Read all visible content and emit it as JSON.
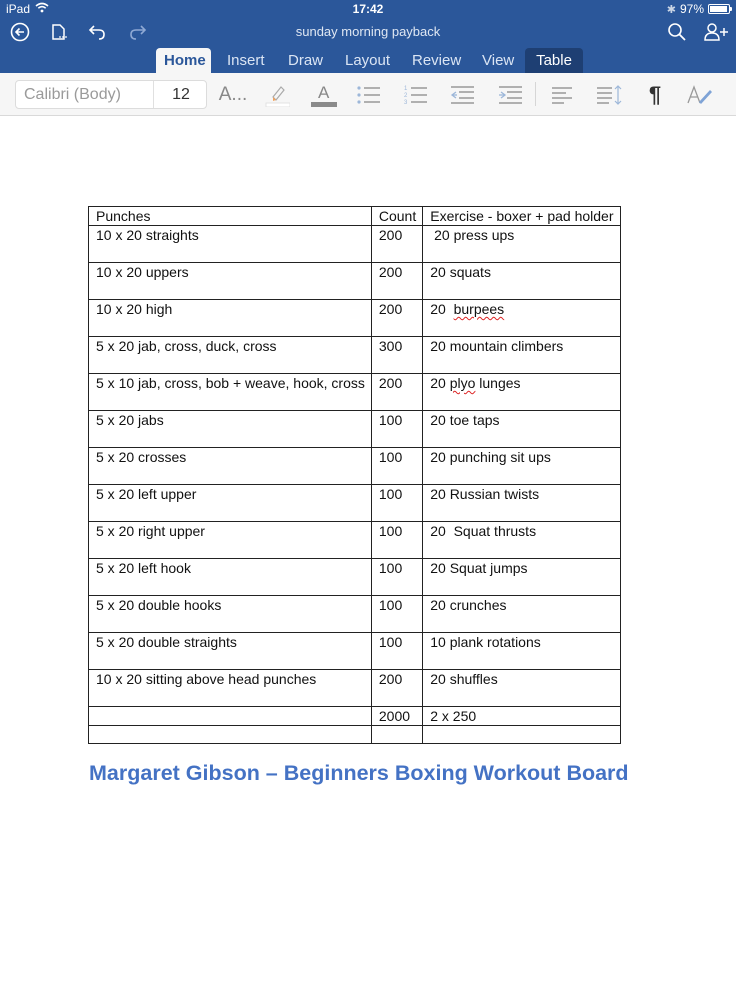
{
  "status_bar": {
    "device": "iPad",
    "time": "17:42",
    "battery": "97%",
    "battery_level": 0.97
  },
  "title_bar": {
    "document_title": "sunday morning payback",
    "icons": [
      "back-icon",
      "file-icon",
      "undo-icon",
      "redo-icon",
      "search-icon",
      "share-person-icon"
    ]
  },
  "tabs": [
    {
      "label": "Home",
      "active": true
    },
    {
      "label": "Insert"
    },
    {
      "label": "Draw"
    },
    {
      "label": "Layout"
    },
    {
      "label": "Review"
    },
    {
      "label": "View"
    },
    {
      "label": "Table",
      "contextual": true
    }
  ],
  "ribbon": {
    "font_name": "Calibri (Body)",
    "font_size": "12",
    "text_effects_label": "A...",
    "font_color_label": "A",
    "icons": [
      "text-effects-icon",
      "highlight-icon",
      "font-color-icon",
      "bullets-icon",
      "numbering-icon",
      "decrease-indent-icon",
      "increase-indent-icon",
      "align-left-icon",
      "line-spacing-icon",
      "paragraph-mark-icon",
      "styles-icon"
    ]
  },
  "document": {
    "table": {
      "headers": [
        "Punches",
        "Count",
        "Exercise - boxer + pad holder"
      ],
      "rows": [
        {
          "punches": "10 x 20  straights",
          "count": "200",
          "exercise": " 20 press ups"
        },
        {
          "punches": "10 x 20  uppers",
          "count": "200",
          "exercise": "20 squats"
        },
        {
          "punches": "10 x 20  high",
          "count": "200",
          "exercise_prefix": "20  ",
          "exercise_flagged": "burpees",
          "exercise_suffix": ""
        },
        {
          "punches": "5 x 20 jab, cross, duck, cross",
          "count": "300",
          "exercise": "20 mountain climbers"
        },
        {
          "punches": "5 x 10  jab, cross, bob + weave, hook, cross",
          "count": "200",
          "exercise_prefix": "20 ",
          "exercise_flagged": "plyo",
          "exercise_suffix": " lunges"
        },
        {
          "punches": "5 x 20  jabs",
          "count": "100",
          "exercise": "20 toe taps"
        },
        {
          "punches": "5 x 20  crosses",
          "count": "100",
          "exercise": "20 punching sit ups"
        },
        {
          "punches": "5 x 20  left upper",
          "count": "100",
          "exercise": "20 Russian twists"
        },
        {
          "punches": "5 x 20  right upper",
          "count": "100",
          "exercise": "20  Squat thrusts"
        },
        {
          "punches": "5 x 20  left hook",
          "count": "100",
          "exercise": "20 Squat jumps"
        },
        {
          "punches": "5 x 20  double hooks",
          "count": "100",
          "exercise": "20 crunches"
        },
        {
          "punches": "5 x 20 double straights",
          "count": "100",
          "exercise": "10 plank rotations"
        },
        {
          "punches": "10 x 20 sitting above head punches",
          "count": "200",
          "exercise": "20 shuffles"
        }
      ],
      "total_row": {
        "punches": "",
        "count": "2000",
        "exercise": "2 x 250"
      },
      "empty_row": {
        "punches": "",
        "count": "",
        "exercise": ""
      }
    },
    "heading": "Margaret Gibson – Beginners Boxing Workout Board"
  },
  "colors": {
    "app_blue": "#2b579a",
    "table_tab": "#1e3f73",
    "heading_blue": "#4472c4",
    "spellcheck_red": "#dd2222"
  }
}
